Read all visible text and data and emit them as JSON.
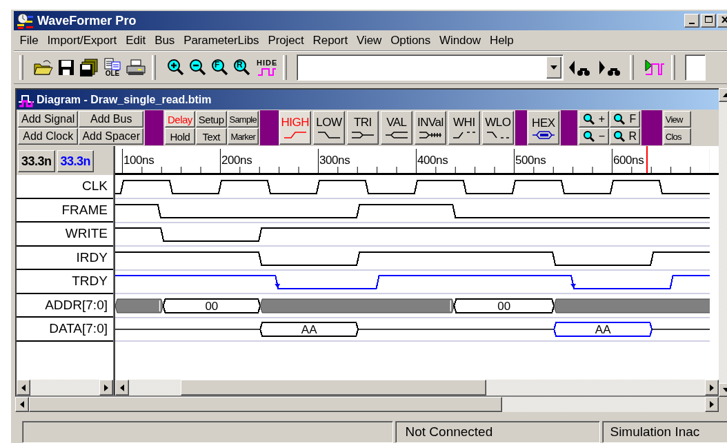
{
  "window": {
    "title": "WaveFormer Pro"
  },
  "menu": [
    "File",
    "Import/Export",
    "Edit",
    "Bus",
    "ParameterLibs",
    "Project",
    "Report",
    "View",
    "Options",
    "Window",
    "Help"
  ],
  "toolbar": [
    {
      "kind": "grip"
    },
    {
      "kind": "open"
    },
    {
      "kind": "save"
    },
    {
      "kind": "save_all"
    },
    {
      "kind": "ole",
      "text": "OLE"
    },
    {
      "kind": "print"
    },
    {
      "kind": "grip"
    },
    {
      "kind": "zoom_in"
    },
    {
      "kind": "zoom_out"
    },
    {
      "kind": "zoom_letter",
      "text": "F"
    },
    {
      "kind": "zoom_letter",
      "text": "R"
    },
    {
      "kind": "hide",
      "text": "HIDE"
    },
    {
      "kind": "grip"
    },
    {
      "kind": "combo"
    },
    {
      "kind": "find_prev"
    },
    {
      "kind": "find_next"
    },
    {
      "kind": "grip"
    },
    {
      "kind": "simulate"
    },
    {
      "kind": "grip"
    },
    {
      "kind": "field"
    }
  ],
  "diagram": {
    "title": "Diagram - Draw_single_read.btim",
    "add_buttons": [
      "Add Signal",
      "Add Bus",
      "Add Clock",
      "Add Spacer"
    ],
    "timing_buttons": [
      {
        "label": "Delay",
        "selected": true
      },
      {
        "label": "Setup",
        "selected": false
      },
      {
        "label": "Sample",
        "selected": false
      },
      {
        "label": "Hold",
        "selected": false
      },
      {
        "label": "Text",
        "selected": false
      },
      {
        "label": "Marker",
        "selected": false
      }
    ],
    "state_buttons": [
      {
        "label": "HIGH",
        "kind": "high",
        "selected": true
      },
      {
        "label": "LOW",
        "kind": "low",
        "selected": false
      },
      {
        "label": "TRI",
        "kind": "tri",
        "selected": false
      },
      {
        "label": "VAL",
        "kind": "val",
        "selected": false
      },
      {
        "label": "INVal",
        "kind": "inval",
        "selected": false
      },
      {
        "label": "WHI",
        "kind": "whi",
        "selected": false
      },
      {
        "label": "WLO",
        "kind": "wlo",
        "selected": false
      }
    ],
    "hex_button": {
      "label": "HEX"
    },
    "zoom_buttons": [
      "+",
      "F",
      "−",
      "R"
    ],
    "window_buttons": [
      "View",
      "Clos"
    ],
    "period_buttons": [
      {
        "label": "33.3n",
        "color": "#000000"
      },
      {
        "label": "33.3n",
        "color": "#0000ff"
      }
    ],
    "ruler": {
      "labels": [
        "100ns",
        "200ns",
        "300ns",
        "400ns",
        "500ns",
        "600ns"
      ]
    },
    "signals": [
      {
        "name": "CLK",
        "kind": "bit",
        "color": "#000000"
      },
      {
        "name": "FRAME",
        "kind": "bit",
        "color": "#000000"
      },
      {
        "name": "WRITE",
        "kind": "bit",
        "color": "#000000"
      },
      {
        "name": "IRDY",
        "kind": "bit",
        "color": "#000000"
      },
      {
        "name": "TRDY",
        "kind": "bit",
        "color": "#0000ff"
      },
      {
        "name": "ADDR[7:0]",
        "kind": "bus",
        "color": "#000000",
        "values": [
          {
            "text": "00"
          },
          {
            "text": "00"
          }
        ]
      },
      {
        "name": "DATA[7:0]",
        "kind": "bus",
        "color": "#000000",
        "values": [
          {
            "text": "AA"
          },
          {
            "text": "AA",
            "color": "#0000ff"
          }
        ]
      }
    ]
  },
  "status_bar": [
    "Not Connected",
    "Simulation Inac"
  ]
}
